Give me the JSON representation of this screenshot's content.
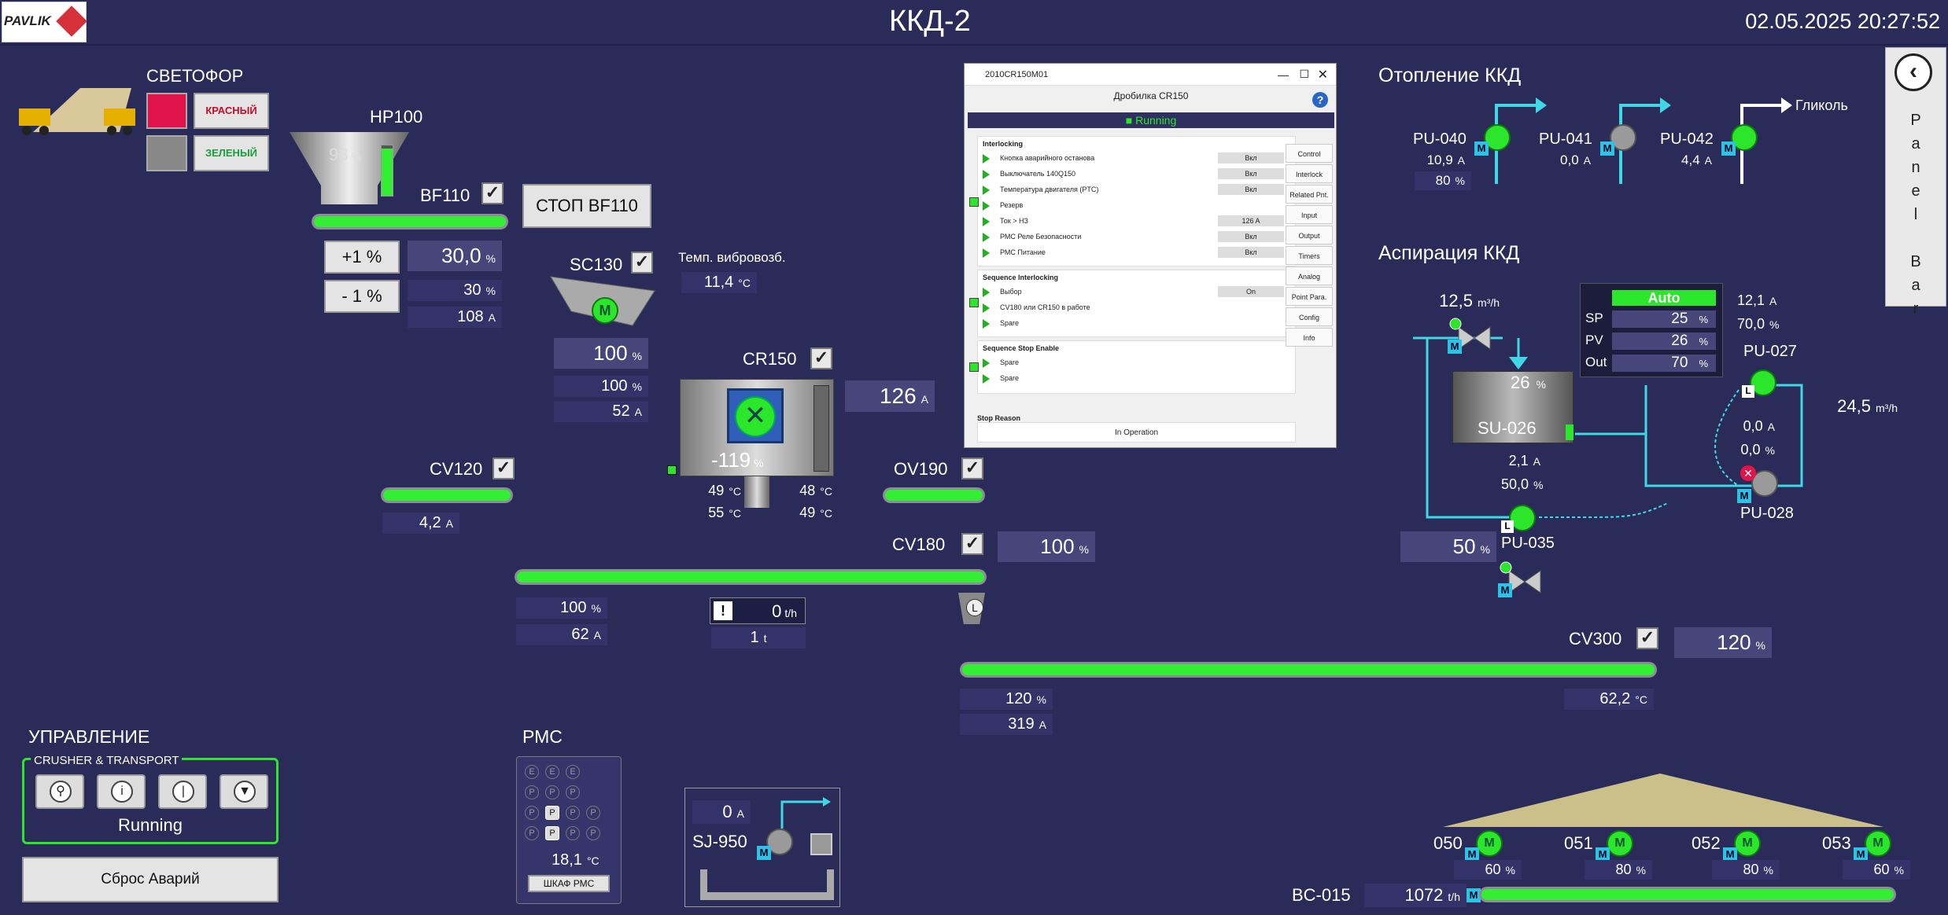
{
  "header": {
    "title": "ККД-2",
    "datetime": "02.05.2025 20:27:52",
    "logo": "PAVLIK"
  },
  "svetofor": {
    "label": "СВЕТОФОР",
    "red": "КРАСНЫЙ",
    "green": "ЗЕЛЕНЫЙ"
  },
  "hp100": {
    "label": "HP100",
    "level": "93",
    "level_unit": "%",
    "level_fraction": 0.93
  },
  "bf110": {
    "label": "BF110",
    "stop_btn": "СТОП  BF110",
    "plus": "+1 %",
    "minus": "- 1 %",
    "sp": "30,0",
    "sp_unit": "%",
    "pv": "30",
    "pv_unit": "%",
    "amps": "108",
    "amps_unit": "A"
  },
  "sc130": {
    "label": "SC130",
    "motor": "M",
    "out": "100",
    "out_unit": "%",
    "pv": "100",
    "pv_unit": "%",
    "amps": "52",
    "amps_unit": "A"
  },
  "vib": {
    "label": "Темп. вибровозб.",
    "value": "11,4",
    "unit": "°C"
  },
  "cr150": {
    "label": "CR150",
    "amps": "126",
    "amps_unit": "A",
    "pos": "-119",
    "pos_unit": "%",
    "t1": "49",
    "t2": "48",
    "t3": "55",
    "t4": "49",
    "tunit": "°C"
  },
  "cv120": {
    "label": "CV120",
    "amps": "4,2",
    "amps_unit": "A"
  },
  "ov190": {
    "label": "OV190"
  },
  "cv180": {
    "label": "CV180",
    "speed": "100",
    "speed_unit": "%",
    "pv": "100",
    "pv_unit": "%",
    "amps": "62",
    "amps_unit": "A",
    "flow": "0",
    "flow_unit": "t/h",
    "total": "1",
    "total_unit": "t",
    "warn": "!",
    "local": "L"
  },
  "cv300": {
    "label": "CV300",
    "speed": "120",
    "speed_unit": "%",
    "pv": "120",
    "pv_unit": "%",
    "amps": "319",
    "amps_unit": "A",
    "temp": "62,2",
    "temp_unit": "°C"
  },
  "popup": {
    "window_title": "2010CR150M01",
    "name": "Дробилка CR150",
    "status": "Running",
    "interlocking_title": "Interlocking",
    "interlocking": [
      {
        "t": "Кнопка аварийного останова",
        "v": "Вкл"
      },
      {
        "t": "Выключатель 140Q150",
        "v": "Вкл"
      },
      {
        "t": "Температура двигателя (PTC)",
        "v": "Вкл"
      },
      {
        "t": "Резерв",
        "v": ""
      },
      {
        "t": "Ток > НЗ",
        "v": "126 A"
      },
      {
        "t": "РМС Реле Безопасности",
        "v": "Вкл"
      },
      {
        "t": "РМС Питание",
        "v": "Вкл"
      }
    ],
    "seq_title": "Sequence Interlocking",
    "seq": [
      {
        "t": "Выбор",
        "v": "On"
      },
      {
        "t": "CV180 или CR150 в работе",
        "v": ""
      },
      {
        "t": "Spare",
        "v": ""
      }
    ],
    "stop_title": "Sequence Stop Enable",
    "stop": [
      {
        "t": "Spare"
      },
      {
        "t": "Spare"
      }
    ],
    "stop_reason_label": "Stop Reason",
    "stop_reason": "In Operation",
    "tabs": [
      "Control",
      "Interlock",
      "Related Pnt.",
      "Input",
      "Output",
      "Timers",
      "Analog",
      "Point Para.",
      "Config",
      "Info"
    ]
  },
  "heating": {
    "title": "Отопление ККД",
    "pumps": [
      {
        "label": "PU-040",
        "amps": "10,9",
        "extra": "80",
        "unit": "A",
        "extra_unit": "%",
        "state": "on"
      },
      {
        "label": "PU-041",
        "amps": "0,0",
        "unit": "A",
        "state": "off"
      },
      {
        "label": "PU-042",
        "amps": "4,4",
        "unit": "A",
        "state": "on"
      }
    ],
    "glycol": "Гликоль"
  },
  "aspiration": {
    "title": "Аспирация ККД",
    "flow1": "12,5",
    "flow_unit": "m³/h",
    "amps_a": "12,1",
    "amps_a_unit": "A",
    "pct_a": "70,0",
    "pct_a_unit": "%",
    "auto": {
      "mode": "Auto",
      "sp": "25",
      "pv": "26",
      "out": "70",
      "unit": "%",
      "sp_label": "SP",
      "pv_label": "PV",
      "out_label": "Out"
    },
    "su026": {
      "label": "SU-026",
      "level": "26",
      "level_unit": "%",
      "amps": "2,1",
      "amps_unit": "A",
      "pct": "50,0",
      "pct_unit": "%"
    },
    "pu027": {
      "label": "PU-027",
      "a": "0,0",
      "a_unit": "A",
      "p": "0,0",
      "p_unit": "%"
    },
    "pu028": {
      "label": "PU-028"
    },
    "pu035": {
      "label": "PU-035",
      "speed": "50",
      "speed_unit": "%"
    },
    "flow2": "24,5",
    "flow2_unit": "m³/h"
  },
  "control": {
    "title": "УПРАВЛЕНИЕ",
    "group": "CRUSHER & TRANSPORT",
    "status": "Running",
    "reset": "Сброс Аварий"
  },
  "rmc": {
    "title": "РМС",
    "temp": "18,1",
    "temp_unit": "°C",
    "btn": "ШКАФ РМС",
    "rows": [
      [
        "E",
        "E",
        "E"
      ],
      [
        "P",
        "P",
        "P"
      ],
      [
        "P",
        "P",
        "P",
        "P"
      ],
      [
        "P",
        "P",
        "P",
        "P"
      ]
    ]
  },
  "sj950": {
    "label": "SJ-950",
    "amps": "0",
    "amps_unit": "A"
  },
  "bc015": {
    "label": "BC-015",
    "flow": "1072",
    "flow_unit": "t/h",
    "feeders": [
      {
        "label": "050",
        "pct": "60"
      },
      {
        "label": "051",
        "pct": "80"
      },
      {
        "label": "052",
        "pct": "80"
      },
      {
        "label": "053",
        "pct": "60"
      }
    ],
    "unit": "%"
  },
  "sidebar": {
    "label": "Panel Bar",
    "back": "‹"
  },
  "colors": {
    "bg": "#2b2b59",
    "running": "#2ce62c",
    "pipe": "#3fd9e6",
    "alarm": "#e0134a"
  }
}
